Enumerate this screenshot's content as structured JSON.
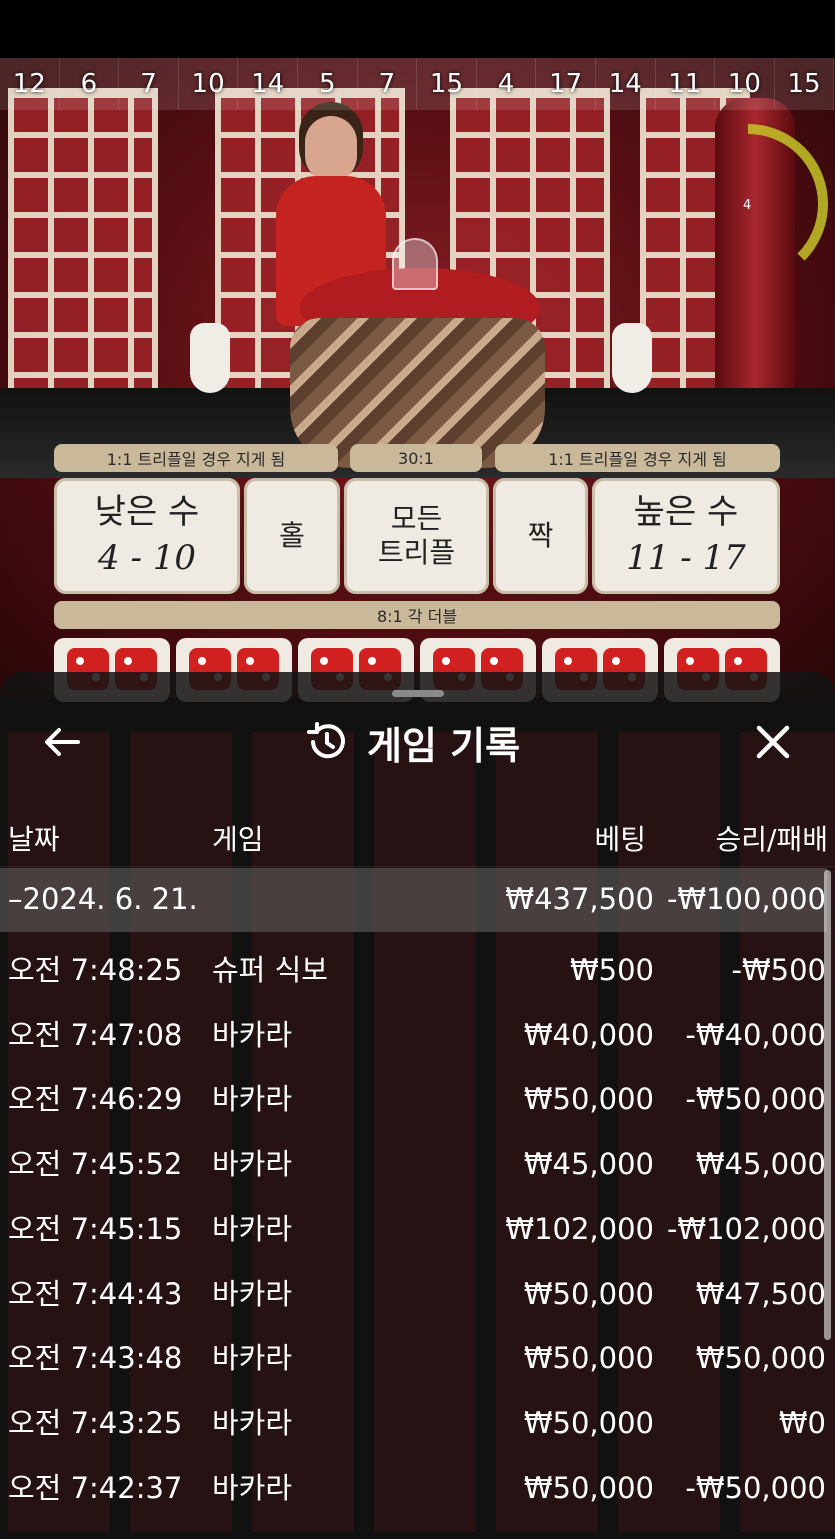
{
  "video": {
    "history": [
      "12",
      "6",
      "7",
      "10",
      "14",
      "5",
      "7",
      "15",
      "4",
      "17",
      "14",
      "11",
      "10",
      "15"
    ],
    "timer_value": "4",
    "timer_color": "#c4c428"
  },
  "board": {
    "triple_lose_left": "1:1 트리플일 경우 지게 됨",
    "any_triple_payout": "30:1",
    "triple_lose_right": "1:1 트리플일 경우 지게 됨",
    "small_label": "낮은 수",
    "small_range": "4 - 10",
    "odd_label": "홀",
    "any_triple_label_1": "모든",
    "any_triple_label_2": "트리플",
    "even_label": "짝",
    "big_label": "높은 수",
    "big_range": "11 - 17",
    "double_payout": "8:1 각 더블"
  },
  "sheet": {
    "title": "게임 기록",
    "back_icon": "arrow-left-icon",
    "history_icon": "history-clock-icon",
    "close_icon": "close-icon",
    "columns": {
      "date": "날짜",
      "game": "게임",
      "bet": "베팅",
      "win_loss": "승리/패배"
    },
    "date_group": {
      "date": "–2024. 6. 21.",
      "bet": "₩437,500",
      "win_loss": "-₩100,000"
    },
    "rows": [
      {
        "time": "오전 7:48:25",
        "game": "슈퍼 식보",
        "bet": "₩500",
        "win_loss": "-₩500"
      },
      {
        "time": "오전 7:47:08",
        "game": "바카라",
        "bet": "₩40,000",
        "win_loss": "-₩40,000"
      },
      {
        "time": "오전 7:46:29",
        "game": "바카라",
        "bet": "₩50,000",
        "win_loss": "-₩50,000"
      },
      {
        "time": "오전 7:45:52",
        "game": "바카라",
        "bet": "₩45,000",
        "win_loss": "₩45,000"
      },
      {
        "time": "오전 7:45:15",
        "game": "바카라",
        "bet": "₩102,000",
        "win_loss": "-₩102,000"
      },
      {
        "time": "오전 7:44:43",
        "game": "바카라",
        "bet": "₩50,000",
        "win_loss": "₩47,500"
      },
      {
        "time": "오전 7:43:48",
        "game": "바카라",
        "bet": "₩50,000",
        "win_loss": "₩50,000"
      },
      {
        "time": "오전 7:43:25",
        "game": "바카라",
        "bet": "₩50,000",
        "win_loss": "₩0"
      },
      {
        "time": "오전 7:42:37",
        "game": "바카라",
        "bet": "₩50,000",
        "win_loss": "-₩50,000"
      }
    ]
  }
}
